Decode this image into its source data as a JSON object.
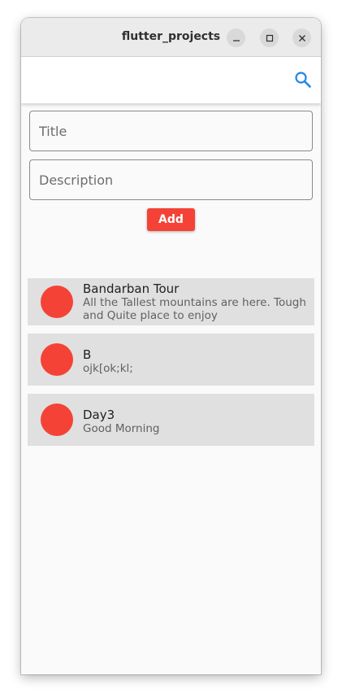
{
  "window": {
    "title": "flutter_projects",
    "minimize_icon": "minimize-icon",
    "maximize_icon": "maximize-icon",
    "close_icon": "close-icon"
  },
  "appbar": {
    "search_icon": "search-icon",
    "accent_color": "#1e88e5"
  },
  "form": {
    "title_placeholder": "Title",
    "title_value": "",
    "description_placeholder": "Description",
    "description_value": "",
    "add_label": "Add",
    "button_color": "#f44336"
  },
  "notes": [
    {
      "title": "Bandarban Tour",
      "description": "All the Tallest mountains are here. Tough and Quite place to enjoy"
    },
    {
      "title": "B",
      "description": "ojk[ok;kl;"
    },
    {
      "title": "Day3",
      "description": "Good Morning"
    }
  ]
}
